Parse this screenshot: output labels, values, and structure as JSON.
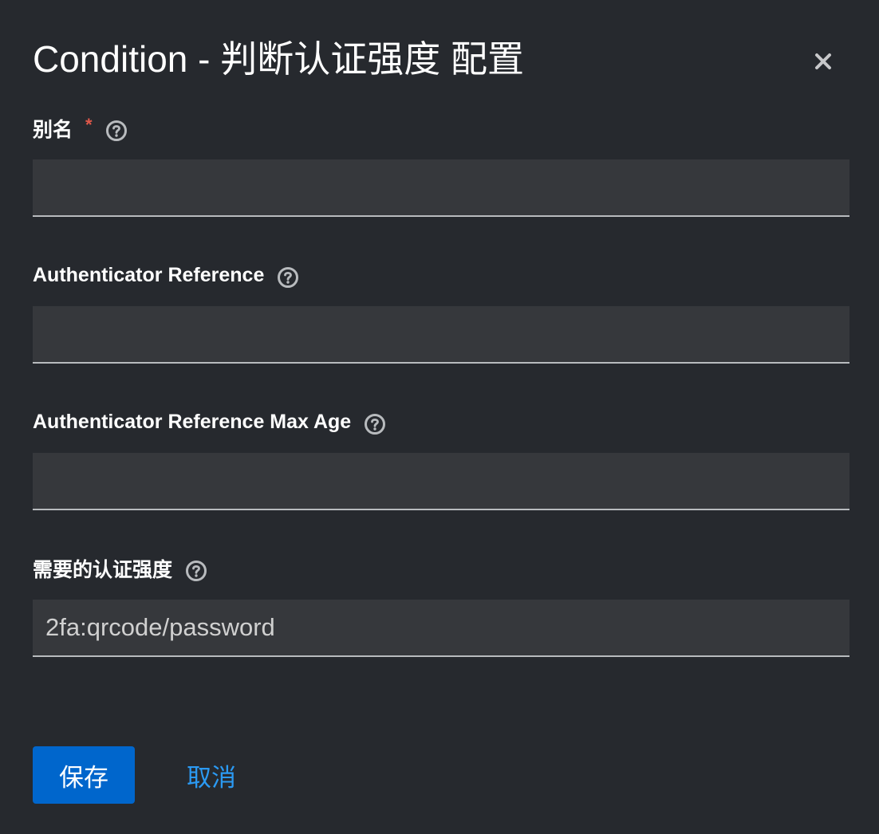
{
  "dialog": {
    "title": "Condition - 判断认证强度 配置",
    "close_label": "×"
  },
  "fields": [
    {
      "label": "别名",
      "required": true,
      "required_mark": "*",
      "value": ""
    },
    {
      "label": "Authenticator Reference",
      "required": false,
      "value": ""
    },
    {
      "label": "Authenticator Reference Max Age",
      "required": false,
      "value": ""
    },
    {
      "label": "需要的认证强度",
      "required": false,
      "value": "2fa:qrcode/password"
    }
  ],
  "actions": {
    "save_label": "保存",
    "cancel_label": "取消"
  },
  "icons": {
    "help": "question-circle-icon",
    "close": "close-icon"
  },
  "colors": {
    "background": "#26292e",
    "input_background": "#36383c",
    "primary": "#0066cc",
    "link": "#2b9af3",
    "required": "#e0584a"
  }
}
